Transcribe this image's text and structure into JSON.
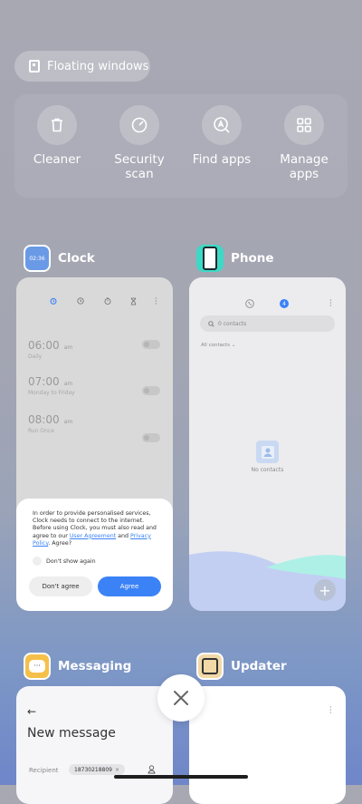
{
  "floating_windows": {
    "label": "Floating windows"
  },
  "quick_tools": [
    {
      "label": "Cleaner",
      "icon": "trash-icon"
    },
    {
      "label": "Security\nscan",
      "icon": "security-scan-icon"
    },
    {
      "label": "Find apps",
      "icon": "find-apps-icon"
    },
    {
      "label": "Manage\napps",
      "icon": "grid-icon"
    }
  ],
  "clock_app": {
    "title": "Clock",
    "icon_text": "02:36",
    "alarms": [
      {
        "time": "06:00",
        "ampm": "am",
        "repeat": "Daily"
      },
      {
        "time": "07:00",
        "ampm": "am",
        "repeat": "Monday to Friday"
      },
      {
        "time": "08:00",
        "ampm": "am",
        "repeat": "Run Once"
      }
    ],
    "dialog": {
      "message_part1": "In order to provide personalised services, Clock needs to connect to the internet. Before using Clock, you must also read and agree to our ",
      "link_user_agreement": "User Agreement",
      "and": " and ",
      "link_privacy_policy": "Privacy Policy",
      "message_end": ". Agree?",
      "dont_show_again": "Don't show again",
      "disagree_label": "Don't agree",
      "agree_label": "Agree"
    }
  },
  "phone_app": {
    "title": "Phone",
    "tab_badge": "4",
    "search_placeholder": "0 contacts",
    "filter_label": "All contacts",
    "empty_label": "No contacts"
  },
  "messaging_app": {
    "title": "Messaging",
    "heading": "New message",
    "recipient_label": "Recipient",
    "recipient_value": "18730218809"
  },
  "updater_app": {
    "title": "Updater"
  },
  "colors": {
    "accent": "#3b82f6",
    "phone_icon": "#3dd9c6",
    "messaging_icon": "#f5c04a"
  }
}
